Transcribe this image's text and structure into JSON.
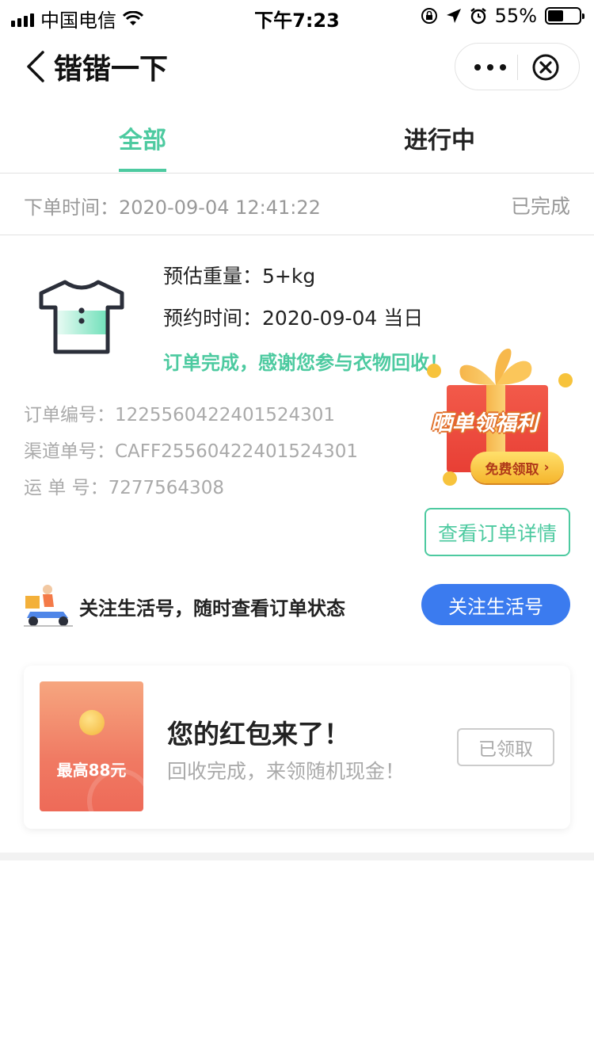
{
  "status_bar": {
    "carrier": "中国电信",
    "time": "下午7:23",
    "battery_percent": "55%",
    "battery_level": 0.55,
    "icons": [
      "signal-icon",
      "wifi-icon",
      "orientation-lock-icon",
      "location-icon",
      "alarm-icon",
      "battery-icon"
    ]
  },
  "nav": {
    "title": "锴锴一下",
    "back_icon": "chevron-left-icon",
    "more_icon": "more-dots-icon",
    "close_icon": "close-circle-icon"
  },
  "tabs": [
    {
      "label": "全部",
      "active": true
    },
    {
      "label": "进行中",
      "active": false
    }
  ],
  "order": {
    "time_label": "下单时间：",
    "time_value": "2020-09-04 12:41:22",
    "status": "已完成",
    "weight_label": "预估重量：",
    "weight_value": "5+kg",
    "appointment_label": "预约时间：",
    "appointment_value": "2020-09-04 当日",
    "thanks": "订单完成，感谢您参与衣物回收！",
    "order_no_label": "订单编号：",
    "order_no": "1225560422401524301",
    "channel_no_label": "渠道单号：",
    "channel_no": "CAFF25560422401524301",
    "waybill_label": "运 单 号：",
    "waybill_no": "7277564308",
    "detail_button": "查看订单详情",
    "item_icon": "tshirt-icon"
  },
  "promo": {
    "banner": "晒单领福利",
    "button": "免费领取",
    "icon": "gift-box-icon"
  },
  "follow": {
    "text": "关注生活号，随时查看订单状态",
    "button": "关注生活号",
    "icon": "delivery-scooter-icon"
  },
  "red_packet": {
    "amount": "最高88元",
    "title": "您的红包来了！",
    "subtitle": "回收完成，来领随机现金！",
    "button": "已领取"
  },
  "colors": {
    "accent_green": "#4dcaa0",
    "follow_blue": "#3b7bef",
    "muted_text": "#999999"
  }
}
